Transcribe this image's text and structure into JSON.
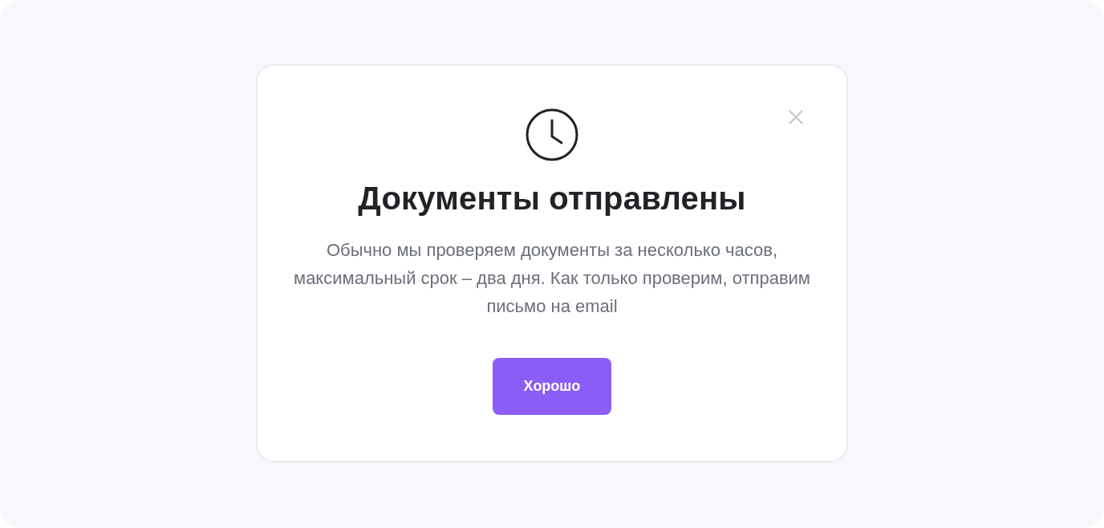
{
  "dialog": {
    "title": "Документы отправлены",
    "message": "Обычно мы проверяем документы за несколько часов, максимальный срок – два дня. Как только проверим, отправим письмо на email",
    "button": "Хорошо"
  }
}
